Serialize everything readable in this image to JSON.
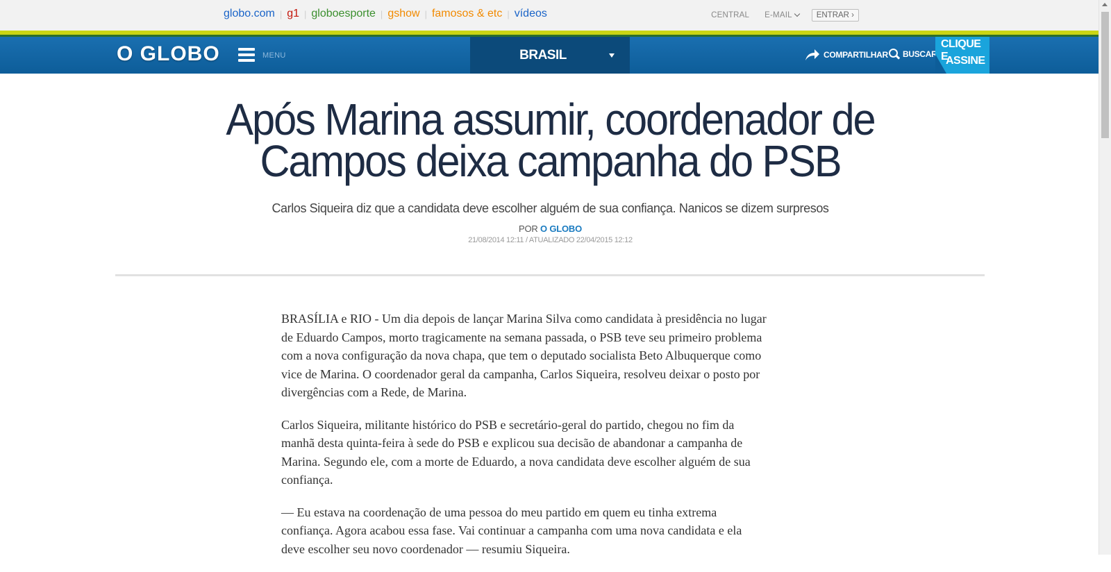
{
  "topbar": {
    "links": [
      {
        "label": "globo.com",
        "color": "#1a64c8"
      },
      {
        "label": "g1",
        "color": "#c4170c"
      },
      {
        "label": "globoesporte",
        "color": "#3b8f2e"
      },
      {
        "label": "gshow",
        "color": "#f28a00"
      },
      {
        "label": "famosos & etc",
        "color": "#f28a00"
      },
      {
        "label": "vídeos",
        "color": "#1a64c8"
      }
    ],
    "central": "CENTRAL",
    "email": "E-MAIL",
    "entrar": "ENTRAR ›"
  },
  "header": {
    "logo": "O GLOBO",
    "menu_label": "MENU",
    "section": "BRASIL",
    "share_label": "COMPARTILHAR",
    "search_label": "BUSCAR",
    "assine_line1": "CLIQUE E",
    "assine_line2": "ASSINE"
  },
  "article": {
    "headline_line1": "Após Marina assumir, coordenador de",
    "headline_line2": "Campos deixa campanha do PSB",
    "subtitle": "Carlos Siqueira diz que a candidata deve escolher alguém de sua confiança. Nanicos se dizem surpresos",
    "by_prefix": "POR",
    "by_source": "O GLOBO",
    "date": "21/08/2014 12:11 / ATUALIZADO 22/04/2015 12:12",
    "paragraphs": [
      "BRASÍLIA e RIO - Um dia depois de lançar Marina Silva como candidata à presidência no lugar de Eduardo Campos, morto tragicamente na semana passada, o PSB teve seu primeiro problema com a nova configuração da nova chapa, que tem o deputado socialista Beto Albuquerque como vice de Marina. O coordenador geral da campanha, Carlos Siqueira, resolveu deixar o posto por divergências com a Rede, de Marina.",
      "Carlos Siqueira, militante histórico do PSB e secretário-geral do partido, chegou no fim da manhã desta quinta-feira à sede do PSB e explicou sua decisão de abandonar a campanha de Marina. Segundo ele, com a morte de Eduardo, a nova candidata deve escolher alguém de sua confiança.",
      "— Eu estava na coordenação de uma pessoa do meu partido em quem eu tinha extrema confiança. Agora acabou essa fase. Vai continuar a campanha com uma nova candidata e ela deve escolher seu novo coordenador — resumiu Siqueira."
    ]
  }
}
